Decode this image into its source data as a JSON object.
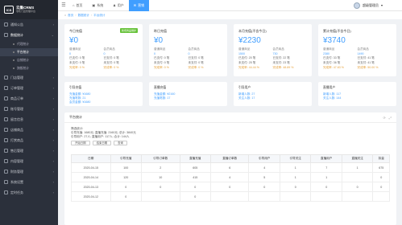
{
  "logo": {
    "mark": "ICS",
    "title": "云集CRMS",
    "subtitle": "零售门店管理平台"
  },
  "sidebar": {
    "items": [
      {
        "label": "通知公告",
        "icon": "bell-icon"
      },
      {
        "label": "数据统计",
        "icon": "chart-icon",
        "open": true,
        "children": [
          {
            "label": "代理统计",
            "active": false
          },
          {
            "label": "平台统计",
            "active": true
          },
          {
            "label": "店铺统计",
            "active": false
          },
          {
            "label": "旗舰统计",
            "active": false
          }
        ]
      },
      {
        "label": "门店管理",
        "icon": "shop-icon"
      },
      {
        "label": "订单管理",
        "icon": "order-icon"
      },
      {
        "label": "商品订单",
        "icon": "goods-icon"
      },
      {
        "label": "账号管理",
        "icon": "account-icon"
      },
      {
        "label": "留言信息",
        "icon": "message-icon"
      },
      {
        "label": "店铺商品",
        "icon": "store-icon"
      },
      {
        "label": "打赏商品",
        "icon": "gift-icon"
      },
      {
        "label": "售后管理",
        "icon": "service-icon"
      },
      {
        "label": "内容管理",
        "icon": "content-icon"
      },
      {
        "label": "财务管理",
        "icon": "finance-icon"
      },
      {
        "label": "系统设置",
        "icon": "settings-icon"
      },
      {
        "label": "定时任务",
        "icon": "clock-icon"
      }
    ]
  },
  "topbar": {
    "menu_icon": "☰",
    "tabs": [
      {
        "label": "首页",
        "active": false
      },
      {
        "label": "系统",
        "active": false
      },
      {
        "label": "用户",
        "active": false
      },
      {
        "label": "营销",
        "active": true
      }
    ],
    "user": "超级管理员"
  },
  "breadcrumb": [
    "首页",
    "数据统计",
    "平台统计"
  ],
  "cards": [
    {
      "title": "今日充值",
      "badge": "新增商品维护",
      "amount": "¥0",
      "col1": "普通商品",
      "col2": "会员商品",
      "rows": [
        [
          "0",
          "0"
        ],
        [
          "已支付: 0 笔",
          "已支付: 0 笔"
        ],
        [
          "未支付: 0 笔",
          "未支付: 0 笔"
        ],
        [
          "完成率: 0 %",
          "完成率: 0 %"
        ]
      ]
    },
    {
      "title": "昨日充值",
      "badge": "",
      "amount": "¥0",
      "col1": "普通商品",
      "col2": "会员商品",
      "rows": [
        [
          "0",
          "0"
        ],
        [
          "已支付: 0 笔",
          "已支付: 0 笔"
        ],
        [
          "未支付: 0 笔",
          "未支付: 0 笔"
        ],
        [
          "完成率: 0 %",
          "完成率: 0 %"
        ]
      ]
    },
    {
      "title": "本月充值(不含今日)",
      "badge": "",
      "amount": "¥2230",
      "col1": "普通商品",
      "col2": "会员商品",
      "rows": [
        [
          "1500",
          "730"
        ],
        [
          "已支付: 20 笔",
          "已支付: 22 笔"
        ],
        [
          "未支付: 25 笔",
          "未支付: 23 笔"
        ],
        [
          "完成率: 44.44 %",
          "完成率: 48.89 %"
        ]
      ]
    },
    {
      "title": "累计充值(不含今日)",
      "badge": "",
      "amount": "¥3740",
      "col1": "普通商品",
      "col2": "会员商品",
      "rows": [
        [
          "2380",
          "1490"
        ],
        [
          "已支付: 33 笔",
          "已支付: 41 笔"
        ],
        [
          "未支付: 36 笔",
          "未支付: 41 笔"
        ],
        [
          "完成率: 47.83 %",
          "完成率: 50.00 %"
        ]
      ]
    }
  ],
  "stat_cards": [
    {
      "title": "引导充值",
      "lines": [
        "充值金额: ¥1680",
        "充值笔数: 21",
        "会员金额: ¥1680"
      ]
    },
    {
      "title": "直播充值",
      "lines": [
        "充值金额: ¥2160",
        "充值笔数: 17"
      ]
    },
    {
      "title": "引导用户",
      "lines": [
        "新增人数: 27",
        "关注人数: 17"
      ]
    },
    {
      "title": "直播用户",
      "lines": [
        "新增人数: 117",
        "关注人数: 144"
      ]
    }
  ],
  "panel": {
    "title": "平台统计",
    "summary_label": "筛选统计:",
    "line1": "引导充值: 1680元;  直播充值: 2160元;  总计: 3840元",
    "line2": "引导用户: 27人;  直播用户: 117人;  合计: 144人",
    "btn1": "开始日期",
    "btn2": "结束日期",
    "btn3": "查询"
  },
  "table": {
    "headers": [
      "日期",
      "引导充值",
      "引导订单数",
      "直播充值",
      "直播订单数",
      "引导用户",
      "引导关注",
      "直播用户",
      "直播关注",
      "扣量"
    ],
    "rows": [
      [
        "2020-04-15",
        "100",
        "2",
        "605",
        "6",
        "4",
        "1",
        "7",
        "1",
        "675"
      ],
      [
        "2020-04-14",
        "120",
        "10",
        "415",
        "4",
        "5",
        "1",
        "1",
        "",
        "0"
      ],
      [
        "2020-04-13",
        "0",
        "0",
        "0",
        "0",
        "0",
        "0",
        "0",
        "0",
        "0"
      ],
      [
        "2020-04-12",
        "0",
        "",
        "0",
        "",
        "",
        "",
        "",
        "",
        ""
      ]
    ]
  }
}
